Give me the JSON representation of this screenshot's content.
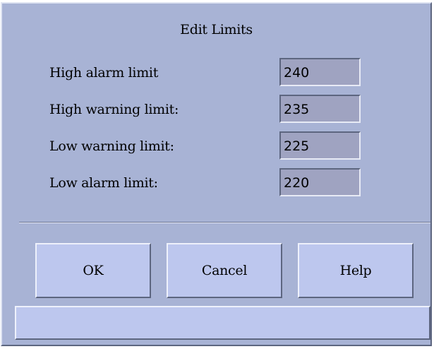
{
  "dialog": {
    "title": "Edit Limits"
  },
  "limits": [
    {
      "label": "High alarm limit",
      "value": "240"
    },
    {
      "label": "High warning limit:",
      "value": "235"
    },
    {
      "label": "Low warning limit:",
      "value": "225"
    },
    {
      "label": "Low alarm limit:",
      "value": "220"
    }
  ],
  "buttons": {
    "ok": "OK",
    "cancel": "Cancel",
    "help": "Help"
  },
  "status_bar": {
    "text": ""
  },
  "colors": {
    "dialog_bg": "#a8b3d5",
    "field_bg": "#9fa3c1",
    "button_bg": "#bdc7ee"
  }
}
